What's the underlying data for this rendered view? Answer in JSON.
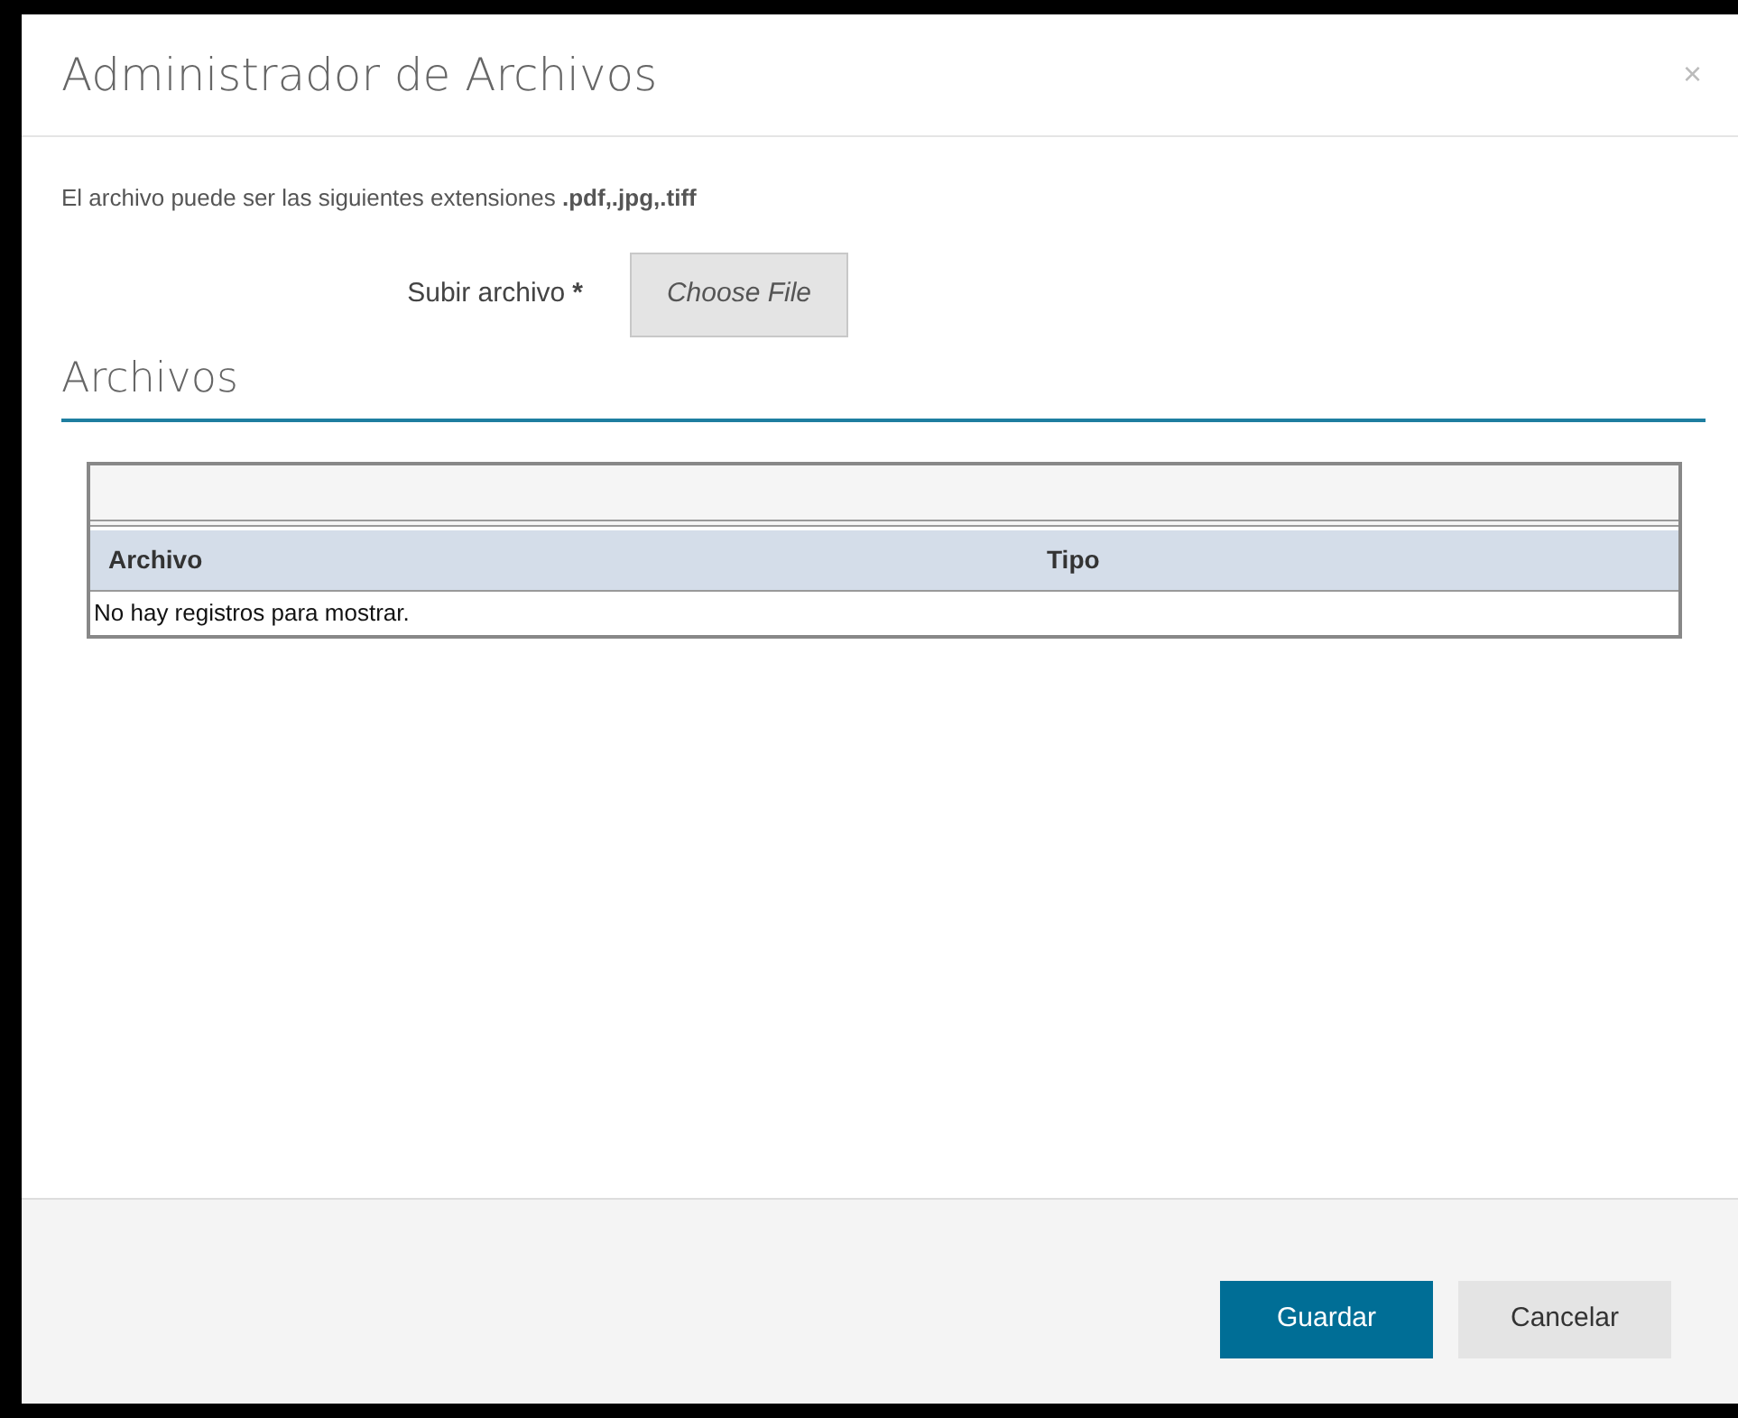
{
  "dialog": {
    "title": "Administrador de Archivos",
    "close": "×"
  },
  "notice": "El archivo puede ser las siguientes extensiones **.pdf,.jpg,.tiff**",
  "upload": {
    "label": "Subir archivo",
    "required": true,
    "required_mark": "*",
    "button": "Choose File"
  },
  "section_title": "Archivos",
  "table": {
    "columns": [
      "Archivo",
      "Tipo"
    ],
    "empty_message": "No hay registros para mostrar."
  },
  "buttons": [
    {
      "label": "Guardar",
      "kind": "primary"
    },
    {
      "label": "Cancelar",
      "kind": "secondary"
    }
  ]
}
